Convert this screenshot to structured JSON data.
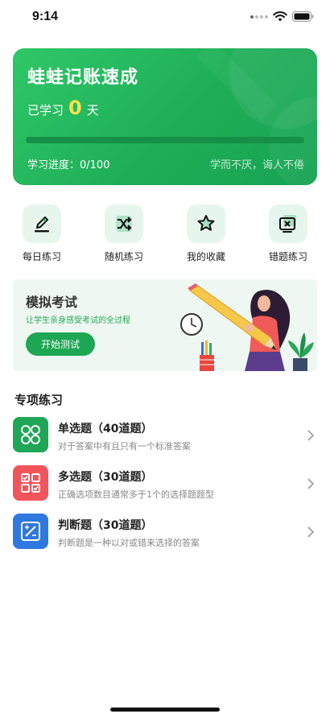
{
  "status": {
    "time": "9:14"
  },
  "hero": {
    "title": "蛙蛙记账速成",
    "learned_prefix": "已学习",
    "days": "0",
    "days_suffix": "天",
    "progress_label": "学习进度：0/100",
    "progress_fraction": 0.0,
    "motto": "学而不厌，诲人不倦"
  },
  "actions": [
    {
      "label": "每日练习",
      "icon": "pencil-icon"
    },
    {
      "label": "随机练习",
      "icon": "shuffle-icon"
    },
    {
      "label": "我的收藏",
      "icon": "star-icon"
    },
    {
      "label": "错题练习",
      "icon": "wrong-answer-icon"
    }
  ],
  "exam": {
    "title": "模拟考试",
    "subtitle": "让学生亲身感受考试的全过程",
    "button": "开始测试"
  },
  "section_title": "专项练习",
  "practice": [
    {
      "title": "单选题（40道题）",
      "desc": "对于答案中有且只有一个标准答案",
      "color": "#1fa656",
      "icon": "circles-grid-icon"
    },
    {
      "title": "多选题（30道题）",
      "desc": "正确选项数目通常多于1个的选择题题型",
      "color": "#f2545b",
      "icon": "checklist-icon"
    },
    {
      "title": "判断题（30道题）",
      "desc": "判断题是一种以对或错来选择的答案",
      "color": "#2f78e0",
      "icon": "true-false-icon"
    }
  ],
  "colors": {
    "accent": "#1fae58",
    "highlight": "#f8e24a"
  }
}
